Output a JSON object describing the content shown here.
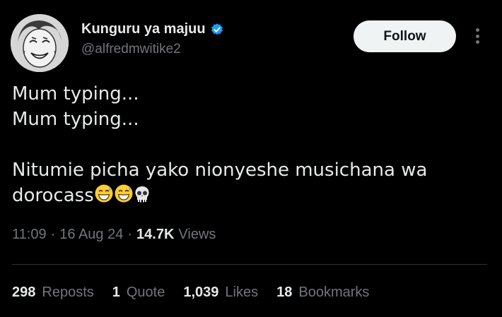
{
  "author": {
    "display_name": "Kunguru ya majuu",
    "handle": "@alfredmwitike2",
    "verified_icon": "verified-badge-icon",
    "avatar_icon": "laughing-man-avatar"
  },
  "header": {
    "follow_label": "Follow",
    "more_icon": "more-vertical-icon"
  },
  "tweet": {
    "lines": [
      "Mum typing...",
      "Mum typing...",
      "",
      "Nitumie picha yako nionyeshe musichana wa",
      "dorocass"
    ],
    "emojis": [
      "grinning-sweat-emoji",
      "grinning-sweat-emoji",
      "skull-emoji"
    ]
  },
  "meta": {
    "time": "11:09",
    "separator": "·",
    "date": "16 Aug 24",
    "views_count": "14.7K",
    "views_label": "Views"
  },
  "stats": [
    {
      "count": "298",
      "label": "Reposts"
    },
    {
      "count": "1",
      "label": "Quote"
    },
    {
      "count": "1,039",
      "label": "Likes"
    },
    {
      "count": "18",
      "label": "Bookmarks"
    }
  ],
  "colors": {
    "background": "#000000",
    "text": "#e7e9ea",
    "secondary": "#71767b",
    "verified": "#1d9bf0",
    "button_bg": "#eff3f4",
    "divider": "#2f3336"
  }
}
